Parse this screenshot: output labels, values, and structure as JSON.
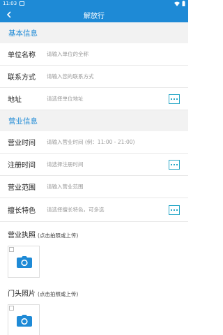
{
  "status": {
    "time": "11:03"
  },
  "header": {
    "title": "解放行"
  },
  "sections": {
    "basic": "基本信息",
    "business": "营业信息"
  },
  "fields": {
    "unit_name": {
      "label": "单位名称",
      "placeholder": "请输入单位的全称"
    },
    "contact": {
      "label": "联系方式",
      "placeholder": "请输入您的联系方式"
    },
    "address": {
      "label": "地址",
      "placeholder": "请选择单位地址"
    },
    "hours": {
      "label": "营业时间",
      "placeholder": "请输入营业时间 (例：11:00 - 21:00)"
    },
    "reg_time": {
      "label": "注册时间",
      "placeholder": "请选择注册时间"
    },
    "scope": {
      "label": "营业范围",
      "placeholder": "请输入营业范围"
    },
    "specialty": {
      "label": "擅长特色",
      "placeholder": "请选择擅长特色，可多选"
    }
  },
  "uploads": {
    "license": {
      "title": "营业执照",
      "hint": "(点击拍照或上传)"
    },
    "storefront": {
      "title": "门头照片",
      "hint": "(点击拍照或上传)"
    }
  },
  "colors": {
    "primary": "#1e8ad6",
    "accent": "#27a7c7"
  }
}
